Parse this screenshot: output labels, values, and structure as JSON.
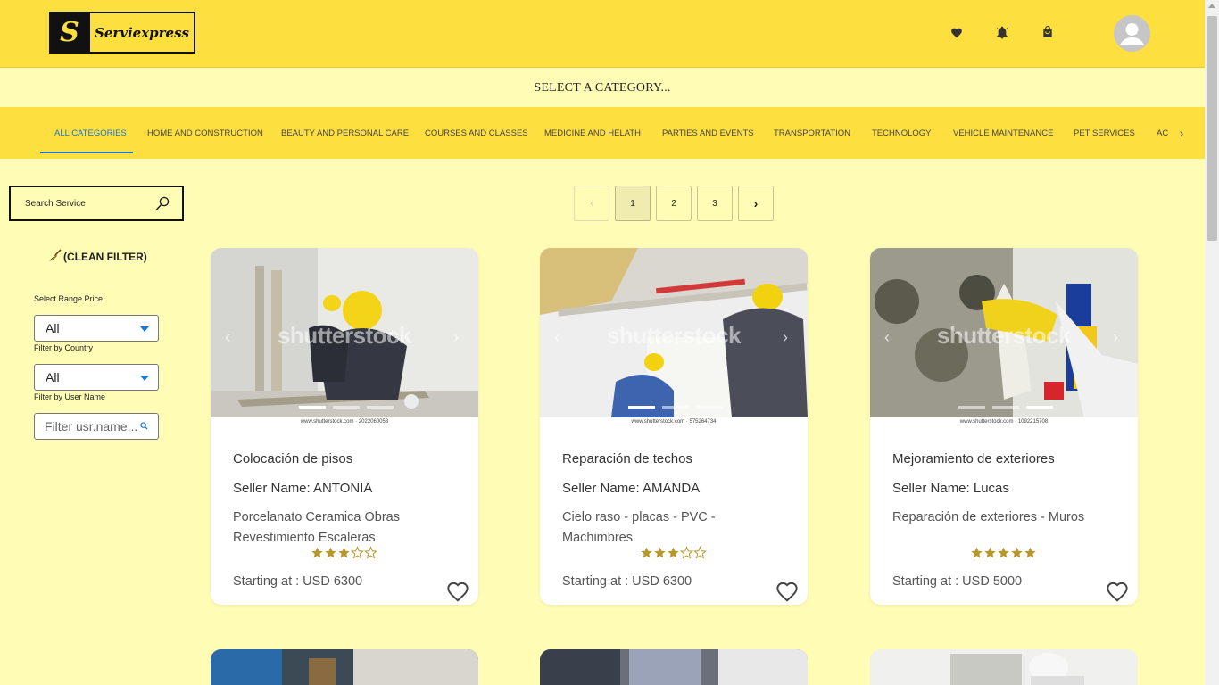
{
  "header": {
    "logo_mark": "S",
    "logo_text": "Serviexpress",
    "icons": [
      "heart-icon",
      "bell-icon",
      "shopping-bag-icon"
    ],
    "avatar": "user-avatar-icon"
  },
  "select_bar": {
    "text": "SELECT A CATEGORY..."
  },
  "categories": {
    "items": [
      {
        "label": "ALL CATEGORIES",
        "active": true
      },
      {
        "label": "HOME AND CONSTRUCTION"
      },
      {
        "label": "BEAUTY AND PERSONAL CARE"
      },
      {
        "label": "COURSES AND CLASSES"
      },
      {
        "label": "MEDICINE AND HELATH"
      },
      {
        "label": "PARTIES AND EVENTS"
      },
      {
        "label": "TRANSPORTATION"
      },
      {
        "label": "TECHNOLOGY"
      },
      {
        "label": "VEHICLE MAINTENANCE"
      },
      {
        "label": "PET SERVICES"
      },
      {
        "label": "AC"
      }
    ],
    "next_icon": "chevron-right-icon"
  },
  "sidebar": {
    "search_label": "Search Service",
    "clean_filter_label": "(CLEAN FILTER)",
    "range_price_label": "Select Range Price",
    "range_price_value": "All",
    "country_label": "Filter by Country",
    "country_value": "All",
    "user_name_label": "Filter by User Name",
    "user_name_placeholder": "Filter usr.name..."
  },
  "pagination": {
    "prev": "‹",
    "pages": [
      "1",
      "2",
      "3"
    ],
    "current": "1",
    "next": "›"
  },
  "cards": [
    {
      "watermark": "shutterstock",
      "credit": "www.shutterstock.com · 2022060053",
      "title": "Colocación de pisos",
      "seller": "Seller Name: ANTONIA",
      "description": "Porcelanato Ceramica Obras Revestimiento Escaleras",
      "rating": 3,
      "price": "Starting at : USD 6300"
    },
    {
      "watermark": "shutterstock",
      "credit": "www.shutterstock.com · 575264734",
      "title": "Reparación de techos",
      "seller": "Seller Name: AMANDA",
      "description": "Cielo raso - placas - PVC - Machimbres",
      "rating": 3,
      "price": "Starting at : USD 6300"
    },
    {
      "watermark": "shutterstock",
      "credit": "www.shutterstock.com · 1092215708",
      "title": "Mejoramiento de exteriores",
      "seller": "Seller Name: Lucas",
      "description": "Reparación de exteriores - Muros",
      "rating": 5,
      "price": "Starting at : USD 5000"
    }
  ],
  "colors": {
    "header_bg": "#fddf3f",
    "page_bg": "#fffdb5",
    "active_tab": "#1976d2",
    "star": "#b8962a"
  }
}
